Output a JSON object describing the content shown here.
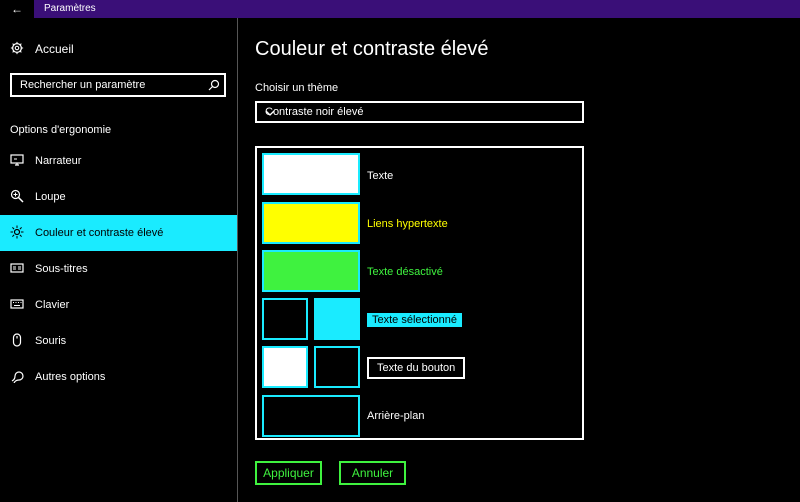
{
  "window": {
    "title": "Paramètres"
  },
  "sidebar": {
    "home_label": "Accueil",
    "search_placeholder": "Rechercher un paramètre",
    "section_heading": "Options d'ergonomie",
    "items": [
      {
        "label": "Narrateur",
        "icon": "narrator-icon"
      },
      {
        "label": "Loupe",
        "icon": "magnifier-icon"
      },
      {
        "label": "Couleur et contraste élevé",
        "icon": "brightness-icon",
        "active": true
      },
      {
        "label": "Sous-titres",
        "icon": "captions-icon"
      },
      {
        "label": "Clavier",
        "icon": "keyboard-icon"
      },
      {
        "label": "Souris",
        "icon": "mouse-icon"
      },
      {
        "label": "Autres options",
        "icon": "other-options-icon"
      }
    ]
  },
  "main": {
    "title": "Couleur et contraste élevé",
    "theme_label": "Choisir un thème",
    "theme_value": "Contraste noir élevé",
    "preview": {
      "text": "Texte",
      "hyperlinks": "Liens hypertexte",
      "disabled_text": "Texte désactivé",
      "selected_text": "Texte sélectionné",
      "button_text": "Texte du bouton",
      "background": "Arrière-plan"
    },
    "apply_label": "Appliquer",
    "cancel_label": "Annuler"
  },
  "colors": {
    "accent": "#1aebff",
    "hyperlink": "#ffff00",
    "disabled": "#3ff23f",
    "titlebar": "#3a0f78"
  }
}
